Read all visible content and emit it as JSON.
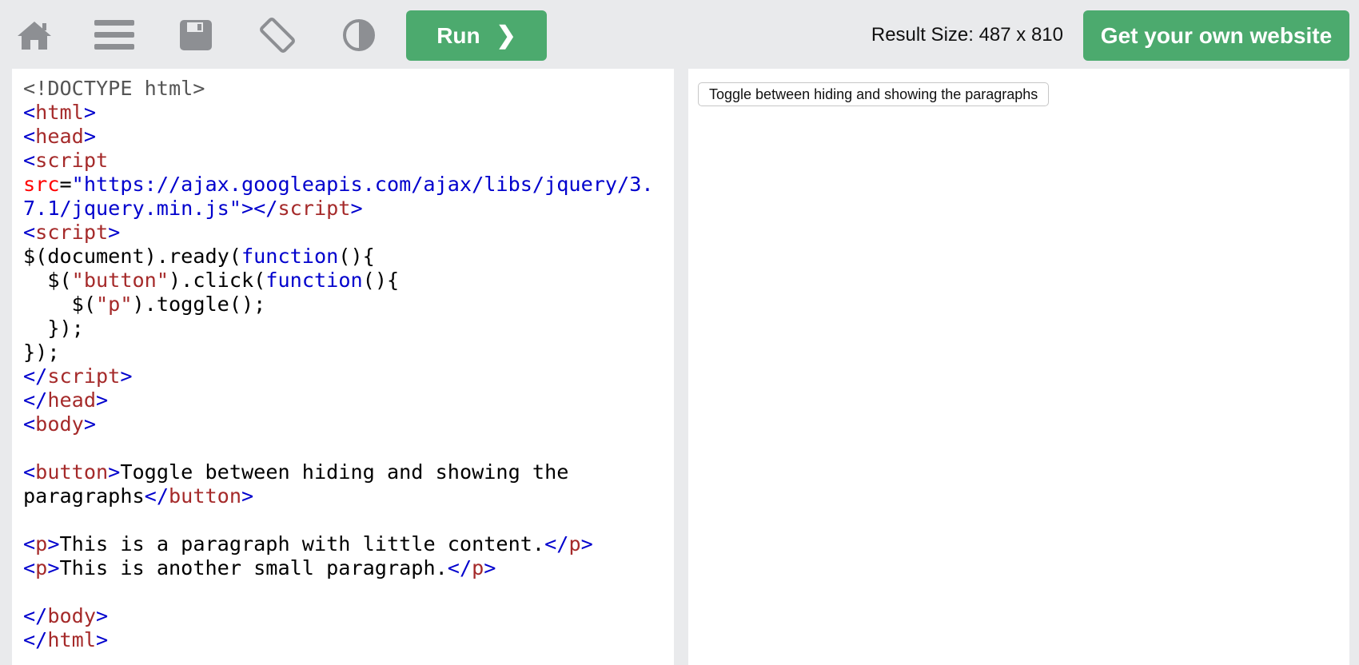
{
  "toolbar": {
    "icons": {
      "home": "home-icon",
      "menu": "menu-icon",
      "save": "save-icon",
      "rotate": "rotate-icon",
      "contrast": "contrast-icon"
    },
    "run_label": "Run",
    "run_chevron": "❯",
    "result_size": "Result Size: 487 x 810",
    "own_website_label": "Get your own website"
  },
  "colors": {
    "accent_green": "#4caa6e",
    "background": "#e9eaec",
    "icon_gray": "#8d8f93"
  },
  "editor": {
    "code": [
      {
        "doctype": "<!DOCTYPE html>"
      },
      {
        "open": "<",
        "tag": "html",
        "close": ">"
      },
      {
        "open": "<",
        "tag": "head",
        "close": ">"
      },
      {
        "open": "<",
        "tag": "script"
      },
      {
        "attr": "src",
        "eq": "=",
        "val": "\"https://ajax.googleapis.com/ajax/libs/jquery/3."
      },
      {
        "val": "7.1/jquery.min.js\"",
        "open": "></",
        "tag": "script",
        "close": ">"
      },
      {
        "open": "<",
        "tag": "script",
        "close": ">"
      },
      {
        "pre": "$(document).ready(",
        "kw": "function",
        "post": "(){"
      },
      {
        "pre": "  $(",
        "str": "\"button\"",
        "mid": ").click(",
        "kw": "function",
        "post": "(){"
      },
      {
        "pre": "    $(",
        "str": "\"p\"",
        "post": ").toggle();"
      },
      {
        "pre": "  });"
      },
      {
        "pre": "});"
      },
      {
        "open": "</",
        "tag": "script",
        "close": ">"
      },
      {
        "open": "</",
        "tag": "head",
        "close": ">"
      },
      {
        "open": "<",
        "tag": "body",
        "close": ">"
      },
      {},
      {
        "open": "<",
        "tag": "button",
        "close": ">",
        "text": "Toggle between hiding and showing the"
      },
      {
        "text": "paragraphs",
        "open": "</",
        "tag": "button",
        "close": ">"
      },
      {},
      {
        "open": "<",
        "tag": "p",
        "close": ">",
        "text": "This is a paragraph with little content.",
        "open2": "</",
        "tag2": "p",
        "close2": ">"
      },
      {
        "open": "<",
        "tag": "p",
        "close": ">",
        "text": "This is another small paragraph.",
        "open2": "</",
        "tag2": "p",
        "close2": ">"
      },
      {},
      {
        "open": "</",
        "tag": "body",
        "close": ">"
      },
      {
        "open": "</",
        "tag": "html",
        "close": ">"
      }
    ]
  },
  "result": {
    "button_label": "Toggle between hiding and showing the paragraphs"
  }
}
